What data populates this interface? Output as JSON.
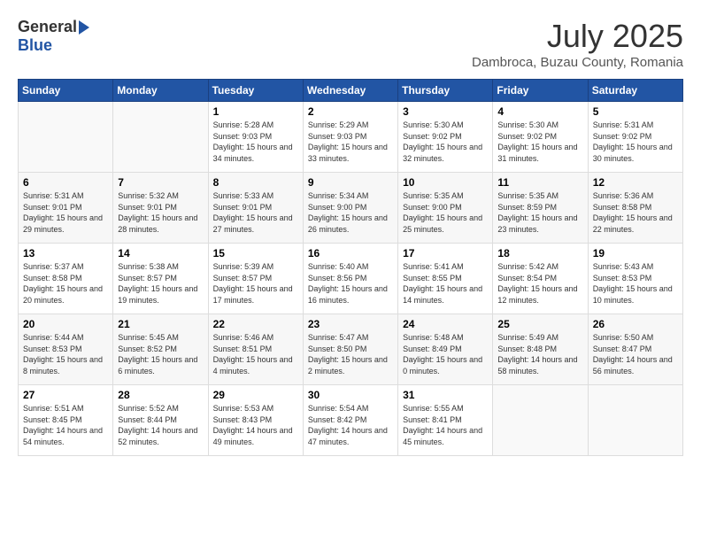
{
  "header": {
    "logo_general": "General",
    "logo_blue": "Blue",
    "month_year": "July 2025",
    "location": "Dambroca, Buzau County, Romania"
  },
  "weekdays": [
    "Sunday",
    "Monday",
    "Tuesday",
    "Wednesday",
    "Thursday",
    "Friday",
    "Saturday"
  ],
  "weeks": [
    [
      {
        "day": "",
        "info": ""
      },
      {
        "day": "",
        "info": ""
      },
      {
        "day": "1",
        "info": "Sunrise: 5:28 AM\nSunset: 9:03 PM\nDaylight: 15 hours and 34 minutes."
      },
      {
        "day": "2",
        "info": "Sunrise: 5:29 AM\nSunset: 9:03 PM\nDaylight: 15 hours and 33 minutes."
      },
      {
        "day": "3",
        "info": "Sunrise: 5:30 AM\nSunset: 9:02 PM\nDaylight: 15 hours and 32 minutes."
      },
      {
        "day": "4",
        "info": "Sunrise: 5:30 AM\nSunset: 9:02 PM\nDaylight: 15 hours and 31 minutes."
      },
      {
        "day": "5",
        "info": "Sunrise: 5:31 AM\nSunset: 9:02 PM\nDaylight: 15 hours and 30 minutes."
      }
    ],
    [
      {
        "day": "6",
        "info": "Sunrise: 5:31 AM\nSunset: 9:01 PM\nDaylight: 15 hours and 29 minutes."
      },
      {
        "day": "7",
        "info": "Sunrise: 5:32 AM\nSunset: 9:01 PM\nDaylight: 15 hours and 28 minutes."
      },
      {
        "day": "8",
        "info": "Sunrise: 5:33 AM\nSunset: 9:01 PM\nDaylight: 15 hours and 27 minutes."
      },
      {
        "day": "9",
        "info": "Sunrise: 5:34 AM\nSunset: 9:00 PM\nDaylight: 15 hours and 26 minutes."
      },
      {
        "day": "10",
        "info": "Sunrise: 5:35 AM\nSunset: 9:00 PM\nDaylight: 15 hours and 25 minutes."
      },
      {
        "day": "11",
        "info": "Sunrise: 5:35 AM\nSunset: 8:59 PM\nDaylight: 15 hours and 23 minutes."
      },
      {
        "day": "12",
        "info": "Sunrise: 5:36 AM\nSunset: 8:58 PM\nDaylight: 15 hours and 22 minutes."
      }
    ],
    [
      {
        "day": "13",
        "info": "Sunrise: 5:37 AM\nSunset: 8:58 PM\nDaylight: 15 hours and 20 minutes."
      },
      {
        "day": "14",
        "info": "Sunrise: 5:38 AM\nSunset: 8:57 PM\nDaylight: 15 hours and 19 minutes."
      },
      {
        "day": "15",
        "info": "Sunrise: 5:39 AM\nSunset: 8:57 PM\nDaylight: 15 hours and 17 minutes."
      },
      {
        "day": "16",
        "info": "Sunrise: 5:40 AM\nSunset: 8:56 PM\nDaylight: 15 hours and 16 minutes."
      },
      {
        "day": "17",
        "info": "Sunrise: 5:41 AM\nSunset: 8:55 PM\nDaylight: 15 hours and 14 minutes."
      },
      {
        "day": "18",
        "info": "Sunrise: 5:42 AM\nSunset: 8:54 PM\nDaylight: 15 hours and 12 minutes."
      },
      {
        "day": "19",
        "info": "Sunrise: 5:43 AM\nSunset: 8:53 PM\nDaylight: 15 hours and 10 minutes."
      }
    ],
    [
      {
        "day": "20",
        "info": "Sunrise: 5:44 AM\nSunset: 8:53 PM\nDaylight: 15 hours and 8 minutes."
      },
      {
        "day": "21",
        "info": "Sunrise: 5:45 AM\nSunset: 8:52 PM\nDaylight: 15 hours and 6 minutes."
      },
      {
        "day": "22",
        "info": "Sunrise: 5:46 AM\nSunset: 8:51 PM\nDaylight: 15 hours and 4 minutes."
      },
      {
        "day": "23",
        "info": "Sunrise: 5:47 AM\nSunset: 8:50 PM\nDaylight: 15 hours and 2 minutes."
      },
      {
        "day": "24",
        "info": "Sunrise: 5:48 AM\nSunset: 8:49 PM\nDaylight: 15 hours and 0 minutes."
      },
      {
        "day": "25",
        "info": "Sunrise: 5:49 AM\nSunset: 8:48 PM\nDaylight: 14 hours and 58 minutes."
      },
      {
        "day": "26",
        "info": "Sunrise: 5:50 AM\nSunset: 8:47 PM\nDaylight: 14 hours and 56 minutes."
      }
    ],
    [
      {
        "day": "27",
        "info": "Sunrise: 5:51 AM\nSunset: 8:45 PM\nDaylight: 14 hours and 54 minutes."
      },
      {
        "day": "28",
        "info": "Sunrise: 5:52 AM\nSunset: 8:44 PM\nDaylight: 14 hours and 52 minutes."
      },
      {
        "day": "29",
        "info": "Sunrise: 5:53 AM\nSunset: 8:43 PM\nDaylight: 14 hours and 49 minutes."
      },
      {
        "day": "30",
        "info": "Sunrise: 5:54 AM\nSunset: 8:42 PM\nDaylight: 14 hours and 47 minutes."
      },
      {
        "day": "31",
        "info": "Sunrise: 5:55 AM\nSunset: 8:41 PM\nDaylight: 14 hours and 45 minutes."
      },
      {
        "day": "",
        "info": ""
      },
      {
        "day": "",
        "info": ""
      }
    ]
  ]
}
